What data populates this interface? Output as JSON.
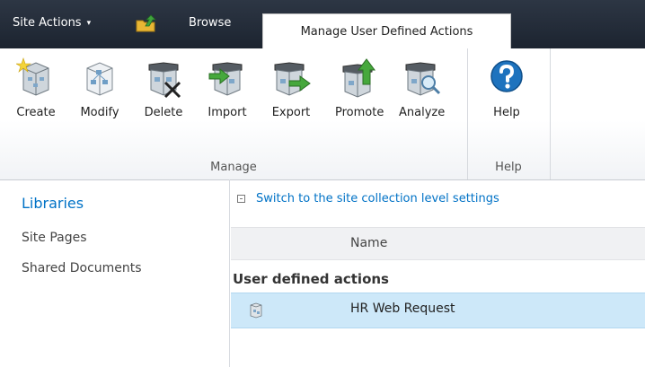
{
  "topbar": {
    "site_actions": "Site Actions",
    "site_actions_caret": "▾",
    "tabs": [
      "Browse",
      "Manage User Defined Actions"
    ]
  },
  "ribbon": {
    "manage": {
      "label": "Manage",
      "buttons": [
        "Create",
        "Modify",
        "Delete",
        "Import",
        "Export",
        "Promote",
        "Analyze"
      ]
    },
    "help": {
      "label": "Help",
      "buttons": [
        "Help"
      ]
    }
  },
  "leftnav": {
    "heading": "Libraries",
    "items": [
      "Site Pages",
      "Shared Documents"
    ]
  },
  "main": {
    "switch_link": "Switch to the site collection level settings",
    "column_header": "Name",
    "group_heading": "User defined actions",
    "rows": [
      {
        "name": "HR Web Request"
      }
    ]
  },
  "colors": {
    "topbar": "#1c2430",
    "link": "#0072c6",
    "selected_row": "#cde8f9"
  }
}
